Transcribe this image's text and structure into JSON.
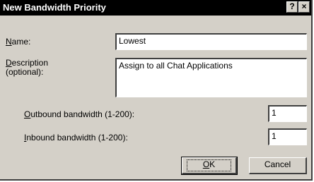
{
  "window": {
    "title": "New Bandwidth Priority",
    "help_glyph": "?",
    "close_glyph": "×"
  },
  "form": {
    "name": {
      "label_accel": "N",
      "label_rest": "ame:",
      "value": "Lowest"
    },
    "description": {
      "label_accel": "D",
      "label_rest": "escription",
      "label_line2": "(optional):",
      "value": "Assign to all Chat Applications"
    },
    "outbound": {
      "label_accel": "O",
      "label_rest": "utbound bandwidth (1-200):",
      "value": "1"
    },
    "inbound": {
      "label_accel": "I",
      "label_rest": "nbound bandwidth (1-200):",
      "value": "1"
    }
  },
  "buttons": {
    "ok_accel": "O",
    "ok_rest": "K",
    "cancel": "Cancel"
  }
}
